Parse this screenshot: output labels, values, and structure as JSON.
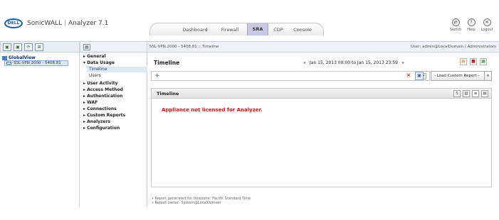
{
  "app": {
    "logo_text": "DELL",
    "product": "SonicWALL",
    "module": "Analyzer 7.1"
  },
  "tabs": [
    {
      "label": "Dashboard",
      "active": false
    },
    {
      "label": "Firewall",
      "active": false
    },
    {
      "label": "SRA",
      "active": true
    },
    {
      "label": "CDP",
      "active": false
    },
    {
      "label": "Console",
      "active": false
    }
  ],
  "top_icons": [
    {
      "name": "switch-icon",
      "glyph": "⇄",
      "label": "Switch"
    },
    {
      "name": "help-icon",
      "glyph": "?",
      "label": "Help"
    },
    {
      "name": "logout-icon",
      "glyph": "✕",
      "label": "Logout"
    }
  ],
  "left_tree": {
    "root": "GlobalView",
    "device": "SSL-VPN 2000 - 5408.81"
  },
  "nav": [
    {
      "label": "General",
      "expanded": false,
      "children": []
    },
    {
      "label": "Data Usage",
      "expanded": true,
      "children": [
        {
          "label": "Timeline",
          "selected": true
        },
        {
          "label": "Users",
          "selected": false
        }
      ]
    },
    {
      "label": "User Activity",
      "expanded": false,
      "children": []
    },
    {
      "label": "Access Method",
      "expanded": false,
      "children": []
    },
    {
      "label": "Authentication",
      "expanded": false,
      "children": []
    },
    {
      "label": "WAF",
      "expanded": false,
      "children": []
    },
    {
      "label": "Connections",
      "expanded": false,
      "children": []
    },
    {
      "label": "Custom Reports",
      "expanded": false,
      "children": []
    },
    {
      "label": "Analyzers",
      "expanded": false,
      "children": []
    },
    {
      "label": "Configuration",
      "expanded": false,
      "children": []
    }
  ],
  "breadcrumb": "SSL-VPN 2000 - 5408.81 :: Timeline",
  "user_info": "User: admin@LocalDomain | Administrators",
  "main": {
    "title": "Timeline",
    "date_range": "Jan 15, 2013 00:00 to Jan 15, 2013 23:59",
    "filter_placeholder": "",
    "load_report_label": "- Load Custom Report -",
    "panel_title": "Timeline",
    "error_message": "Appliance not licensed for Analyzer."
  },
  "footnotes": [
    "• Report generated for timezone: Pacific Standard Time",
    "• Report owner: System@LocalDomain"
  ],
  "colors": {
    "accent": "#1c5ea8",
    "active_tab": "#c9c9e4",
    "error": "#d01818",
    "selected_nav": "#dfe8f5"
  }
}
